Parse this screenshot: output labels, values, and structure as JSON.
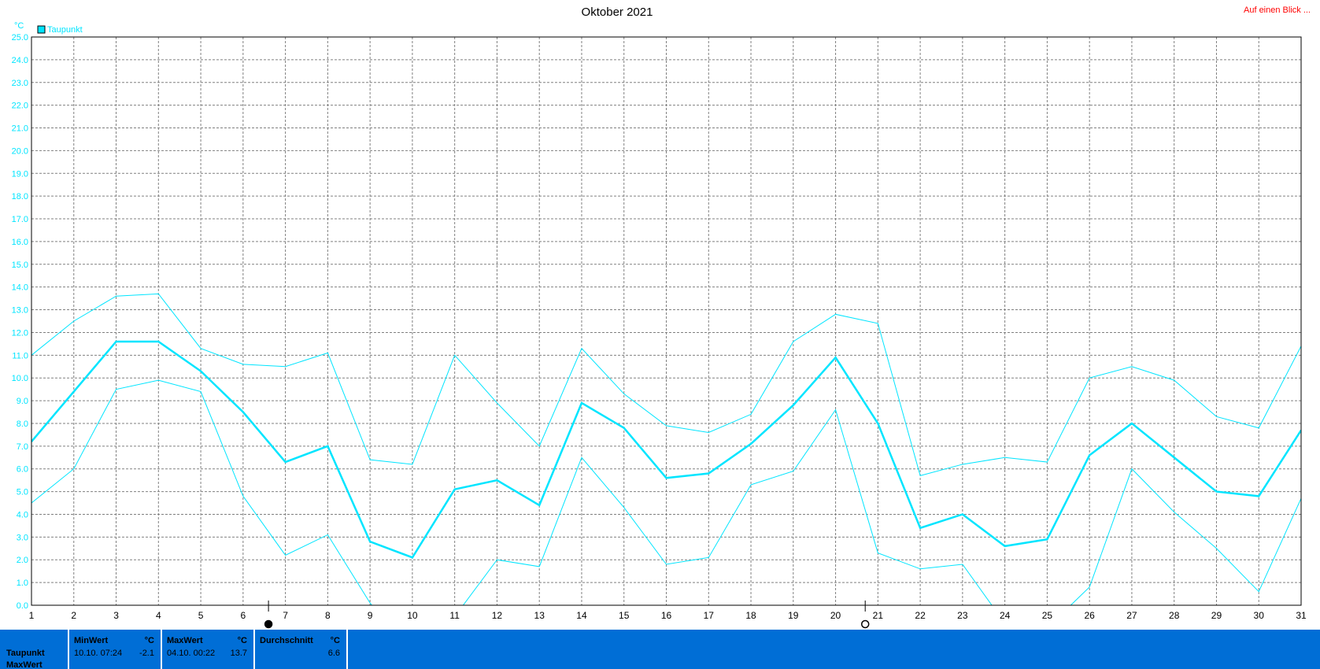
{
  "title": "Oktober 2021",
  "top_link": "Auf einen Blick ...",
  "colors": {
    "series": "#00e5ff",
    "link": "#ff0000",
    "statsbar": "#006ed6",
    "grid": "#808080"
  },
  "chart_data": {
    "type": "line",
    "unit": "°C",
    "x": [
      1,
      2,
      3,
      4,
      5,
      6,
      7,
      8,
      9,
      10,
      11,
      12,
      13,
      14,
      15,
      16,
      17,
      18,
      19,
      20,
      21,
      22,
      23,
      24,
      25,
      26,
      27,
      28,
      29,
      30,
      31
    ],
    "ylim": [
      0,
      25
    ],
    "yticks": [
      "0.0",
      "1.0",
      "2.0",
      "3.0",
      "4.0",
      "5.0",
      "6.0",
      "7.0",
      "8.0",
      "9.0",
      "10.0",
      "11.0",
      "12.0",
      "13.0",
      "14.0",
      "15.0",
      "16.0",
      "17.0",
      "18.0",
      "19.0",
      "20.0",
      "21.0",
      "22.0",
      "23.0",
      "24.0",
      "25.0"
    ],
    "grid": true,
    "legend": "top-left",
    "series": [
      {
        "name": "Taupunkt",
        "role": "mean",
        "values": [
          7.2,
          9.4,
          11.6,
          11.6,
          10.3,
          8.5,
          6.3,
          7.0,
          2.8,
          2.1,
          5.1,
          5.5,
          4.4,
          8.9,
          7.8,
          5.6,
          5.8,
          7.1,
          8.8,
          10.9,
          8.0,
          3.4,
          4.0,
          2.6,
          2.9,
          6.6,
          8.0,
          6.5,
          5.0,
          4.8,
          7.7
        ]
      },
      {
        "role": "max",
        "values": [
          11.0,
          12.5,
          13.6,
          13.7,
          11.3,
          10.6,
          10.5,
          11.1,
          6.4,
          6.2,
          11.0,
          8.9,
          7.0,
          11.3,
          9.3,
          7.9,
          7.6,
          8.4,
          11.6,
          12.8,
          12.4,
          5.7,
          6.2,
          6.5,
          6.3,
          10.0,
          10.5,
          9.9,
          8.3,
          7.8,
          11.4
        ]
      },
      {
        "role": "min",
        "values": [
          4.5,
          6.0,
          9.5,
          9.9,
          9.4,
          4.8,
          2.2,
          3.1,
          0.1,
          -2.1,
          -0.5,
          2.0,
          1.7,
          6.5,
          4.3,
          1.8,
          2.1,
          5.3,
          5.9,
          8.6,
          2.3,
          1.6,
          1.8,
          -0.8,
          -1.0,
          0.8,
          6.0,
          4.1,
          2.5,
          0.6,
          4.7
        ]
      }
    ],
    "markers": [
      {
        "x": 6.6,
        "style": "filled"
      },
      {
        "x": 20.7,
        "style": "open"
      }
    ]
  },
  "stats": {
    "row_label": "Taupunkt",
    "row_label_2": "MaxWert",
    "min": {
      "header": "MinWert",
      "unit": "°C",
      "when": "10.10.  07:24",
      "value": "-2.1"
    },
    "max": {
      "header": "MaxWert",
      "unit": "°C",
      "when": "04.10.  00:22",
      "value": "13.7"
    },
    "avg": {
      "header": "Durchschnitt",
      "unit": "°C",
      "value": "6.6"
    }
  }
}
